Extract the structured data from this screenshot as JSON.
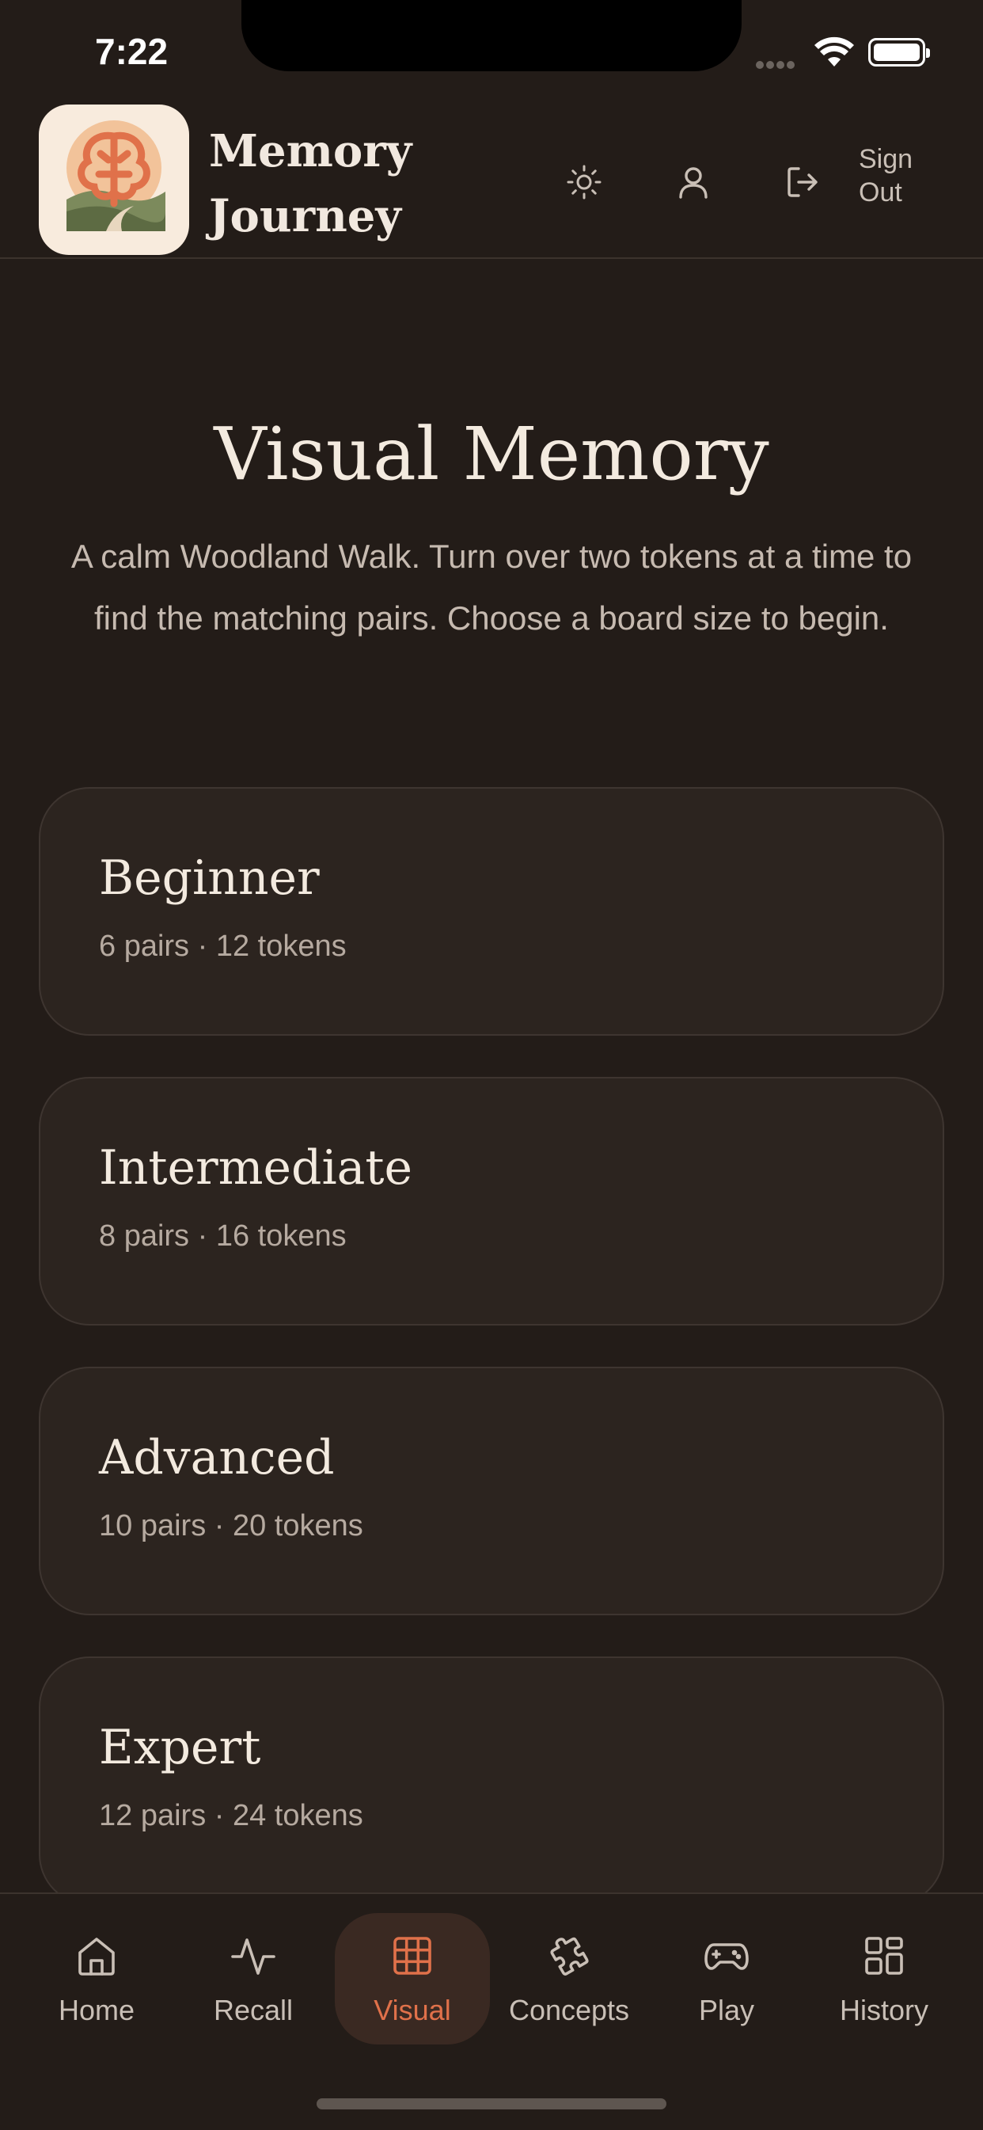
{
  "status": {
    "time": "7:22"
  },
  "header": {
    "title_line1": "Memory",
    "title_line2": "Journey",
    "sign_out": "Sign Out"
  },
  "hero": {
    "title": "Visual Memory",
    "description": "A calm Woodland Walk. Turn over two tokens at a time to find the matching pairs. Choose a board size to begin."
  },
  "levels": [
    {
      "title": "Beginner",
      "subtitle": "6 pairs · 12 tokens"
    },
    {
      "title": "Intermediate",
      "subtitle": "8 pairs · 16 tokens"
    },
    {
      "title": "Advanced",
      "subtitle": "10 pairs · 20 tokens"
    },
    {
      "title": "Expert",
      "subtitle": "12 pairs · 24 tokens"
    }
  ],
  "nav": [
    {
      "label": "Home",
      "icon": "home-icon"
    },
    {
      "label": "Recall",
      "icon": "pulse-icon"
    },
    {
      "label": "Visual",
      "icon": "grid-icon",
      "active": true
    },
    {
      "label": "Concepts",
      "icon": "puzzle-icon"
    },
    {
      "label": "Play",
      "icon": "gamepad-icon"
    },
    {
      "label": "History",
      "icon": "dashboard-icon"
    }
  ],
  "colors": {
    "background": "#231c18",
    "card": "#2c241f",
    "accent": "#e0714a",
    "text": "#f1e8df"
  }
}
